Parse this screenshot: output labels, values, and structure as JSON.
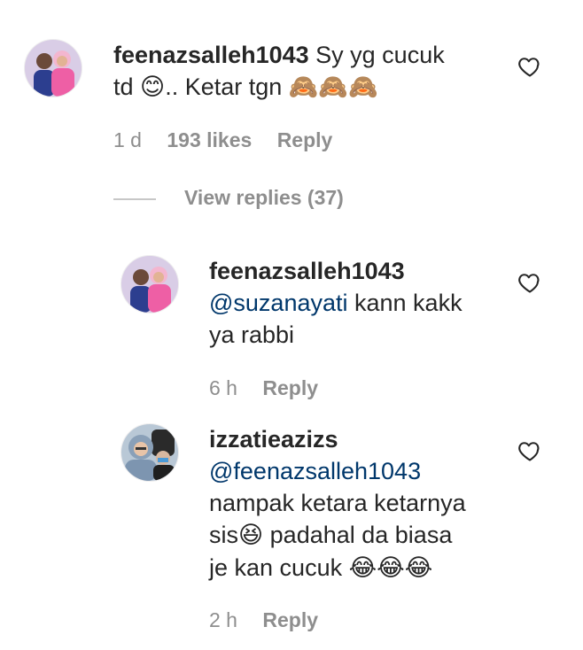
{
  "comments": [
    {
      "username": "feenazsalleh1043",
      "text_line1": "Sy yg cucuk",
      "text_line2_a": "td",
      "emoji_1": "😊",
      "text_line2_b": ".. Ketar tgn",
      "emoji_2": "🙈🙈🙈",
      "time": "1 d",
      "likes": "193 likes",
      "reply_label": "Reply"
    }
  ],
  "view_replies": {
    "label": "View replies (37)"
  },
  "replies": [
    {
      "username": "feenazsalleh1043",
      "mention": "@suzanayati",
      "text_line1_rest": " kann kakk",
      "text_line2": "ya rabbi",
      "time": "6 h",
      "reply_label": "Reply"
    },
    {
      "username": "izzatieazizs",
      "mention": "@feenazsalleh1043",
      "text_line1": "nampak ketara ketarnya",
      "text_line2_a": "sis",
      "emoji_1": "😆",
      "text_line2_b": " padahal da biasa",
      "text_line3_a": "je kan cucuk ",
      "emoji_2": "😂😂😂",
      "time": "2 h",
      "reply_label": "Reply"
    }
  ],
  "icons": {
    "like": "heart-outline-icon"
  },
  "colors": {
    "text": "#262626",
    "muted": "#8e8e8e",
    "mention": "#00376b"
  }
}
